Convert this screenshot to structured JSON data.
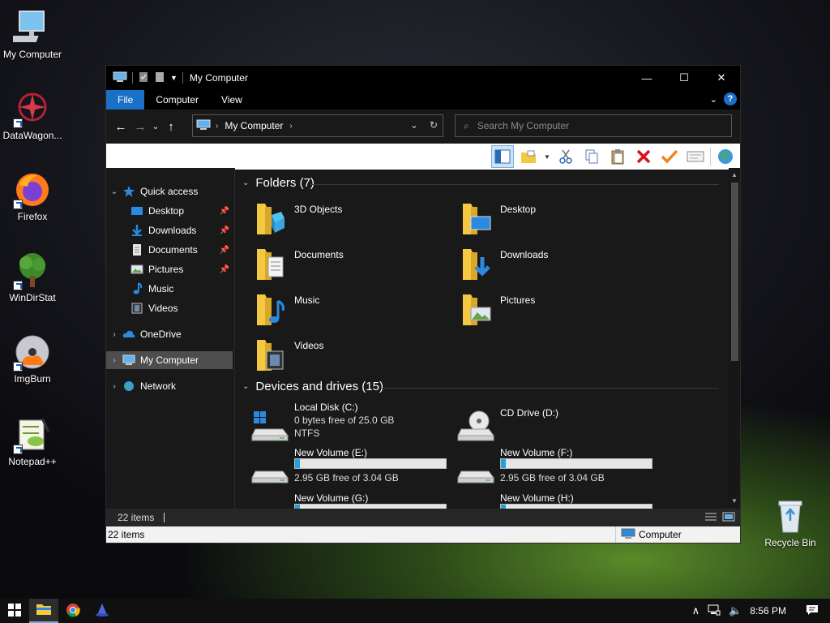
{
  "desktop": {
    "icons": [
      {
        "label": "My Computer"
      },
      {
        "label": "DataWagon..."
      },
      {
        "label": "Firefox"
      },
      {
        "label": "WinDirStat"
      },
      {
        "label": "ImgBurn"
      },
      {
        "label": "Notepad++"
      },
      {
        "label": "Recycle Bin"
      }
    ]
  },
  "window": {
    "title": "My Computer",
    "controls": {
      "minimize": "—",
      "maximize": "☐",
      "close": "✕"
    },
    "ribbon_tabs": [
      {
        "label": "File",
        "active": true
      },
      {
        "label": "Computer"
      },
      {
        "label": "View"
      }
    ],
    "address": {
      "location": "My Computer"
    },
    "search": {
      "placeholder": "Search My Computer"
    }
  },
  "nav_pane": {
    "quick_access": "Quick access",
    "quick_items": [
      {
        "label": "Desktop",
        "pinned": true
      },
      {
        "label": "Downloads",
        "pinned": true
      },
      {
        "label": "Documents",
        "pinned": true
      },
      {
        "label": "Pictures",
        "pinned": true
      },
      {
        "label": "Music",
        "pinned": false
      },
      {
        "label": "Videos",
        "pinned": false
      }
    ],
    "onedrive": "OneDrive",
    "my_computer": "My Computer",
    "network": "Network"
  },
  "main": {
    "folders_header": "Folders (7)",
    "folders": [
      {
        "name": "3D Objects"
      },
      {
        "name": "Desktop"
      },
      {
        "name": "Documents"
      },
      {
        "name": "Downloads"
      },
      {
        "name": "Music"
      },
      {
        "name": "Pictures"
      },
      {
        "name": "Videos"
      }
    ],
    "devices_header": "Devices and drives (15)",
    "drives": [
      {
        "name": "Local Disk (C:)",
        "line1": "0 bytes free of 25.0 GB",
        "line2": "NTFS",
        "type": "system"
      },
      {
        "name": "CD Drive (D:)",
        "type": "cd"
      },
      {
        "name": "New Volume (E:)",
        "free": "2.95 GB free of 3.04 GB",
        "used_fraction": 0.03
      },
      {
        "name": "New Volume (F:)",
        "free": "2.95 GB free of 3.04 GB",
        "used_fraction": 0.03
      },
      {
        "name": "New Volume (G:)",
        "used_fraction": 0.03
      },
      {
        "name": "New Volume (H:)",
        "used_fraction": 0.03
      }
    ]
  },
  "status": {
    "items_dark": "22 items",
    "items_light": "22 items",
    "location": "Computer"
  },
  "taskbar": {
    "time": "8:56 PM"
  }
}
